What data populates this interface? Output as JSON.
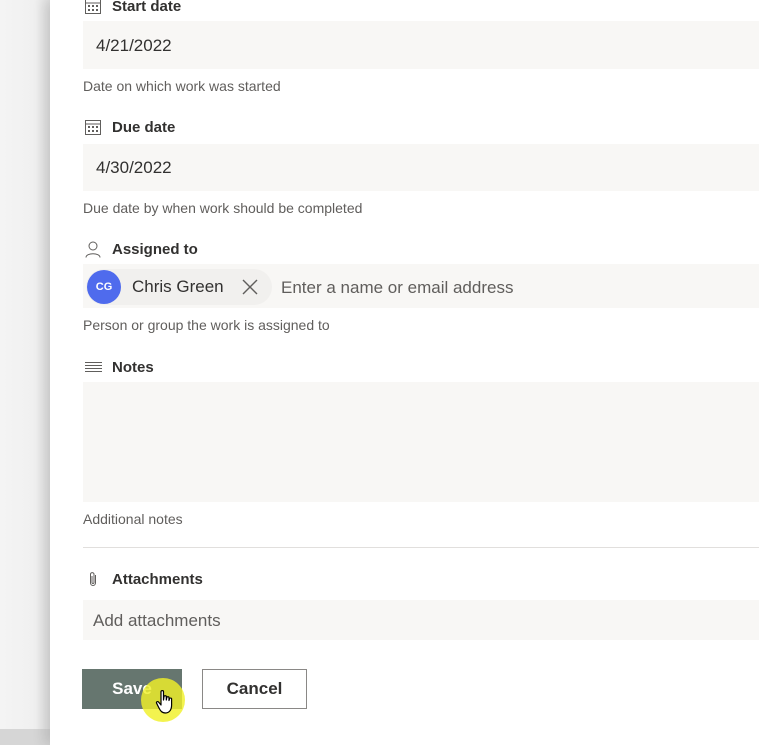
{
  "form": {
    "start_date": {
      "label": "Start date",
      "icon": "calendar-icon",
      "value": "4/21/2022",
      "description": "Date on which work was started"
    },
    "due_date": {
      "label": "Due date",
      "icon": "calendar-icon",
      "value": "4/30/2022",
      "description": "Due date by when work should be completed"
    },
    "assigned_to": {
      "label": "Assigned to",
      "icon": "person-icon",
      "persona": {
        "initials": "CG",
        "name": "Chris Green",
        "avatar_color": "#4f6bed"
      },
      "placeholder": "Enter a name or email address",
      "description": "Person or group the work is assigned to"
    },
    "notes": {
      "label": "Notes",
      "icon": "text-lines-icon",
      "value": "",
      "description": "Additional notes"
    },
    "attachments": {
      "label": "Attachments",
      "icon": "paperclip-icon",
      "placeholder": "Add attachments"
    }
  },
  "actions": {
    "save_label": "Save",
    "cancel_label": "Cancel",
    "save_color": "#66766f"
  },
  "cursor": {
    "icon": "hand-pointer-icon",
    "highlight_color": "#f0f028"
  }
}
